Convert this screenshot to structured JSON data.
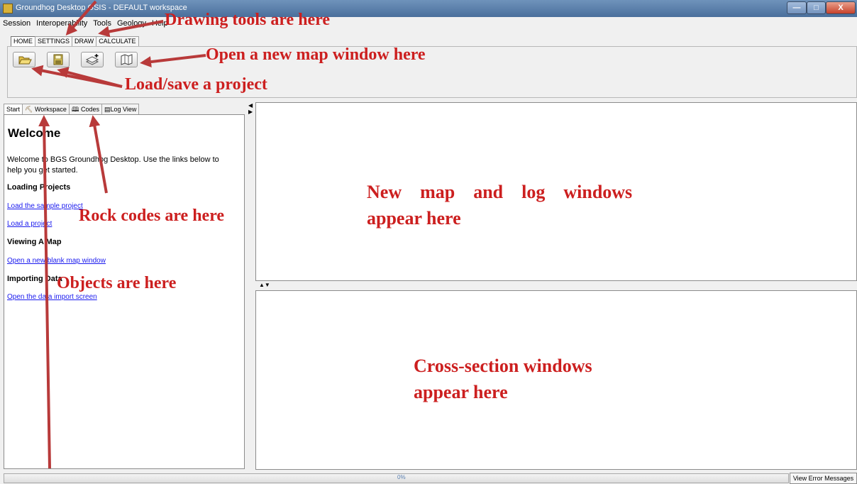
{
  "window": {
    "title": "Groundhog Desktop GSIS - DEFAULT workspace",
    "min_label": "—",
    "max_label": "□",
    "close_label": "X"
  },
  "menu": [
    "Session",
    "Interoperability",
    "Tools",
    "Geology",
    "Help"
  ],
  "ribbon": {
    "tabs": [
      "HOME",
      "SETTINGS",
      "DRAW",
      "CALCULATE"
    ],
    "active_tab": "HOME",
    "buttons": [
      {
        "icon": "open-folder-icon"
      },
      {
        "icon": "save-disk-icon"
      },
      {
        "icon": "add-layers-icon"
      },
      {
        "icon": "map-icon"
      }
    ]
  },
  "sidebar": {
    "tabs": [
      "Start",
      "Workspace",
      "Codes",
      "Log View"
    ],
    "active_tab": "Start",
    "welcome_title": "Welcome",
    "intro": "Welcome to BGS Groundhog Desktop. Use the links below to help you get started.",
    "sections": [
      {
        "heading": "Loading Projects",
        "links": [
          "Load the sample project",
          "Load a project"
        ]
      },
      {
        "heading": "Viewing A Map",
        "links": [
          "Open a new blank map window"
        ]
      },
      {
        "heading": "Importing Data",
        "links": [
          "Open the data import screen"
        ]
      }
    ]
  },
  "status": {
    "progress_text": "0%",
    "error_button": "View Error Messages"
  },
  "annotations": {
    "drawing_tools": "Drawing tools are here",
    "new_map": "Open a new map window here",
    "load_save": "Load/save a project",
    "rock_codes": "Rock codes are here",
    "objects": "Objects are here",
    "map_log_line1": "New    map    and    log    windows",
    "map_log_line2": "appear here",
    "cross_line1": "Cross-section windows",
    "cross_line2": "appear here"
  },
  "colors": {
    "annotation": "#cc1f1f",
    "link": "#1a1aee",
    "titlebar": "#4a6f9c"
  }
}
